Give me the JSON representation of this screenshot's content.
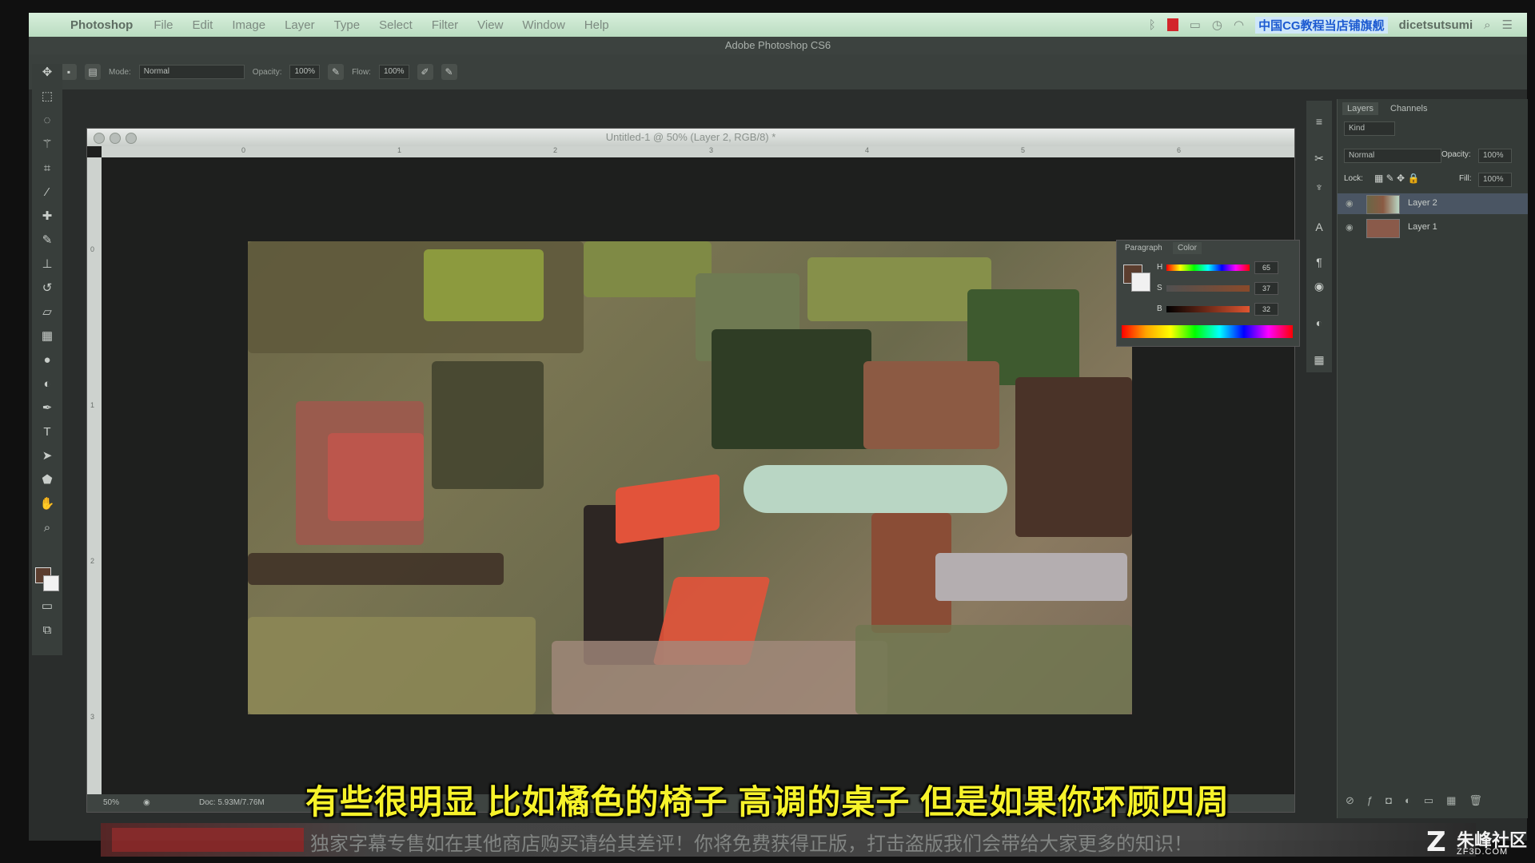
{
  "menubar": {
    "app": "Photoshop",
    "items": [
      "File",
      "Edit",
      "Image",
      "Layer",
      "Type",
      "Select",
      "Filter",
      "View",
      "Window",
      "Help"
    ],
    "notice": "中国CG教程当店铺旗舰",
    "user": "dicetsutsumi"
  },
  "window_title": "Adobe Photoshop CS6",
  "options": {
    "mode_label": "Mode:",
    "mode_value": "Normal",
    "opacity_label": "Opacity:",
    "opacity_value": "100%",
    "flow_label": "Flow:",
    "flow_value": "100%"
  },
  "document": {
    "title": "Untitled-1 @ 50% (Layer 2, RGB/8) *",
    "zoom": "50%",
    "doc_info": "Doc: 5.93M/7.76M",
    "ruler_top": [
      "0",
      "1",
      "2",
      "3",
      "4",
      "5",
      "6"
    ],
    "ruler_left": [
      "0",
      "1",
      "2",
      "3"
    ]
  },
  "layers_panel": {
    "tabs": [
      "Layers",
      "Channels"
    ],
    "kind_label": "Kind",
    "blend_mode": "Normal",
    "opacity_label": "Opacity:",
    "opacity_value": "100%",
    "lock_label": "Lock:",
    "fill_label": "Fill:",
    "fill_value": "100%",
    "layers": [
      {
        "name": "Layer 2",
        "selected": true
      },
      {
        "name": "Layer 1",
        "selected": false
      }
    ]
  },
  "color_panel": {
    "tabs": [
      "Paragraph",
      "Color"
    ],
    "channels": [
      {
        "label": "H",
        "value": "65"
      },
      {
        "label": "S",
        "value": "37"
      },
      {
        "label": "B",
        "value": "32"
      }
    ],
    "unit": "%"
  },
  "subtitle": "有些很明显 比如橘色的椅子 高调的桌子 但是如果你环顾四周",
  "banner_text": "独家字幕专售如在其他商店购买请给其差评！你将免费获得正版，打击盗版我们会带给大家更多的知识！",
  "watermark": {
    "main": "朱峰社区",
    "sub": "ZF3D.COM"
  },
  "colors": {
    "accent": "#f6f22a",
    "chair": "#e2533a",
    "table": "#b9d6c4"
  }
}
